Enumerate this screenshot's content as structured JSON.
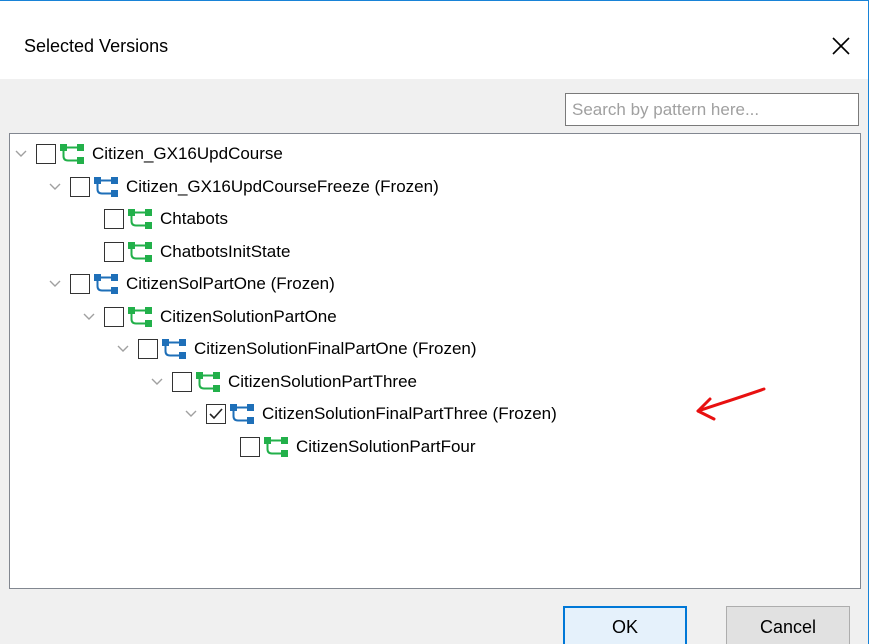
{
  "dialog": {
    "title": "Selected Versions",
    "close_icon": "close-icon"
  },
  "search": {
    "placeholder": "Search by pattern here...",
    "value": ""
  },
  "tree": {
    "nodes": [
      {
        "label": "Citizen_GX16UpdCourse",
        "depth": 0,
        "expanded": true,
        "checked": false,
        "icon": "branch-green-icon"
      },
      {
        "label": "Citizen_GX16UpdCourseFreeze (Frozen)",
        "depth": 1,
        "expanded": true,
        "checked": false,
        "icon": "branch-blue-icon"
      },
      {
        "label": "Chtabots",
        "depth": 2,
        "expanded": false,
        "checked": false,
        "icon": "branch-green-icon"
      },
      {
        "label": "ChatbotsInitState",
        "depth": 2,
        "expanded": false,
        "checked": false,
        "icon": "branch-green-icon"
      },
      {
        "label": "CitizenSolPartOne (Frozen)",
        "depth": 1,
        "expanded": true,
        "checked": false,
        "icon": "branch-blue-icon"
      },
      {
        "label": "CitizenSolutionPartOne",
        "depth": 2,
        "expanded": true,
        "checked": false,
        "icon": "branch-green-icon"
      },
      {
        "label": "CitizenSolutionFinalPartOne (Frozen)",
        "depth": 3,
        "expanded": true,
        "checked": false,
        "icon": "branch-blue-icon"
      },
      {
        "label": "CitizenSolutionPartThree",
        "depth": 4,
        "expanded": true,
        "checked": false,
        "icon": "branch-green-icon"
      },
      {
        "label": "CitizenSolutionFinalPartThree (Frozen)",
        "depth": 5,
        "expanded": true,
        "checked": true,
        "icon": "branch-blue-icon"
      },
      {
        "label": "CitizenSolutionPartFour",
        "depth": 6,
        "expanded": false,
        "checked": false,
        "icon": "branch-green-icon"
      }
    ]
  },
  "annotation": {
    "icon": "red-arrow-icon",
    "color": "#e81010"
  },
  "footer": {
    "ok_label": "OK",
    "cancel_label": "Cancel"
  },
  "colors": {
    "accent": "#0078d7",
    "branch_green": "#22b04a",
    "branch_blue": "#1e6fb8"
  }
}
